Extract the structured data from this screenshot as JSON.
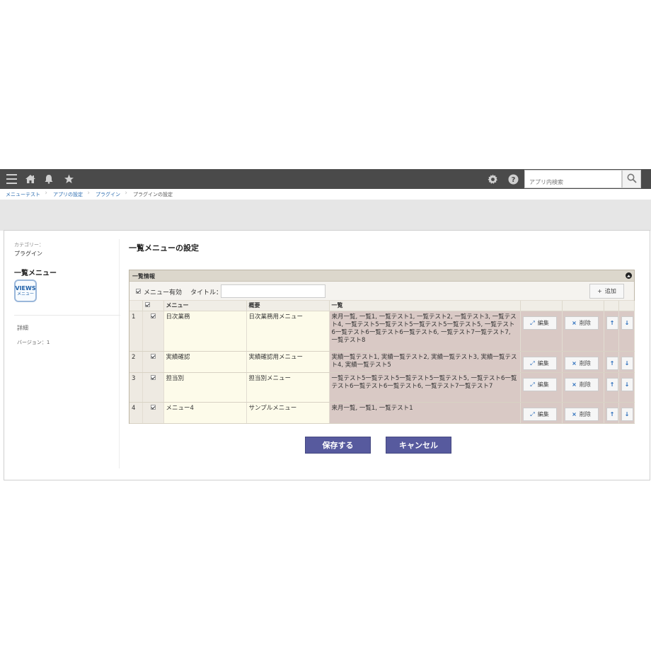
{
  "topbar": {
    "search_placeholder": "アプリ内検索",
    "colors": {
      "bar": "#4a4a4a"
    }
  },
  "breadcrumb": [
    "メニューテスト",
    "アプリの設定",
    "プラグイン",
    "プラグインの設定"
  ],
  "sidebar": {
    "category_label": "カテゴリー：",
    "category_value": "プラグイン",
    "plugin_name": "一覧メニュー",
    "icon_text_top": "VIEWS",
    "icon_text_bottom": "メニュー",
    "detail_link": "詳細",
    "version": "バージョン：1"
  },
  "main": {
    "page_title": "一覧メニューの設定",
    "list_info": {
      "title": "一覧情報",
      "menu_enabled_label": "メニュー有効",
      "menu_enabled_checked": true,
      "title_label": "タイトル：",
      "title_value": "",
      "add_button": "追加",
      "columns": [
        "メニュー",
        "概要",
        "一覧"
      ],
      "rows": [
        {
          "num": "1",
          "checked": true,
          "menu": "日次業務",
          "summary": "日次業務用メニュー",
          "list": "来月一覧, 一覧1, 一覧テスト1, 一覧テスト2, 一覧テスト3, 一覧テスト4, 一覧テスト5一覧テスト5一覧テスト5一覧テスト5, 一覧テスト6一覧テスト6一覧テスト6一覧テスト6, 一覧テスト7一覧テスト7, 一覧テスト8"
        },
        {
          "num": "2",
          "checked": true,
          "menu": "実績確認",
          "summary": "実績確認用メニュー",
          "list": "実績一覧テスト1, 実績一覧テスト2, 実績一覧テスト3, 実績一覧テスト4, 実績一覧テスト5"
        },
        {
          "num": "3",
          "checked": true,
          "menu": "担当別",
          "summary": "担当別メニュー",
          "list": "一覧テスト5一覧テスト5一覧テスト5一覧テスト5, 一覧テスト6一覧テスト6一覧テスト6一覧テスト6, 一覧テスト7一覧テスト7"
        },
        {
          "num": "4",
          "checked": true,
          "menu": "メニュー4",
          "summary": "サンプルメニュー",
          "list": "来月一覧, 一覧1, 一覧テスト1"
        }
      ],
      "row_actions": {
        "edit": "編集",
        "delete": "削除"
      }
    },
    "save_button": "保存する",
    "cancel_button": "キャンセル",
    "colors": {
      "button": "#575a9e",
      "list_cell": "#d9c9c5",
      "menu_cell": "#fdfbea"
    }
  }
}
